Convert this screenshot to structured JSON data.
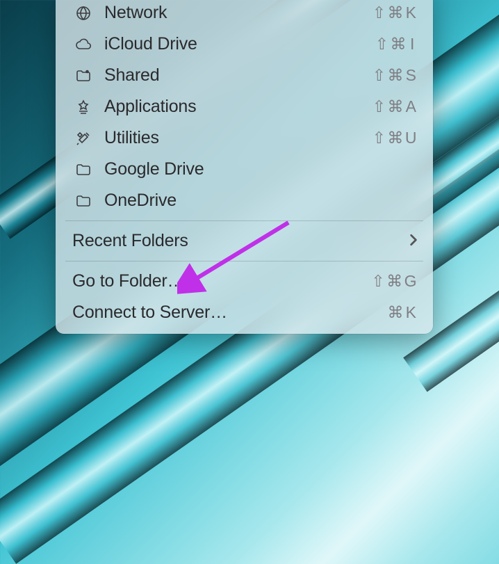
{
  "menu": {
    "items": [
      {
        "label": "Network",
        "icon": "globe-icon",
        "shortcut": "⇧⌘K"
      },
      {
        "label": "iCloud Drive",
        "icon": "cloud-icon",
        "shortcut": "⇧⌘I"
      },
      {
        "label": "Shared",
        "icon": "folder-shared-icon",
        "shortcut": "⇧⌘S"
      },
      {
        "label": "Applications",
        "icon": "applications-icon",
        "shortcut": "⇧⌘A"
      },
      {
        "label": "Utilities",
        "icon": "utilities-icon",
        "shortcut": "⇧⌘U"
      },
      {
        "label": "Google Drive",
        "icon": "folder-icon",
        "shortcut": ""
      },
      {
        "label": "OneDrive",
        "icon": "folder-icon",
        "shortcut": ""
      }
    ],
    "recent": {
      "label": "Recent Folders"
    },
    "goto": {
      "label": "Go to Folder…",
      "shortcut": "⇧⌘G"
    },
    "connect": {
      "label": "Connect to Server…",
      "shortcut": "⌘K"
    }
  },
  "annotation": {
    "arrow_color": "#c030e8"
  }
}
